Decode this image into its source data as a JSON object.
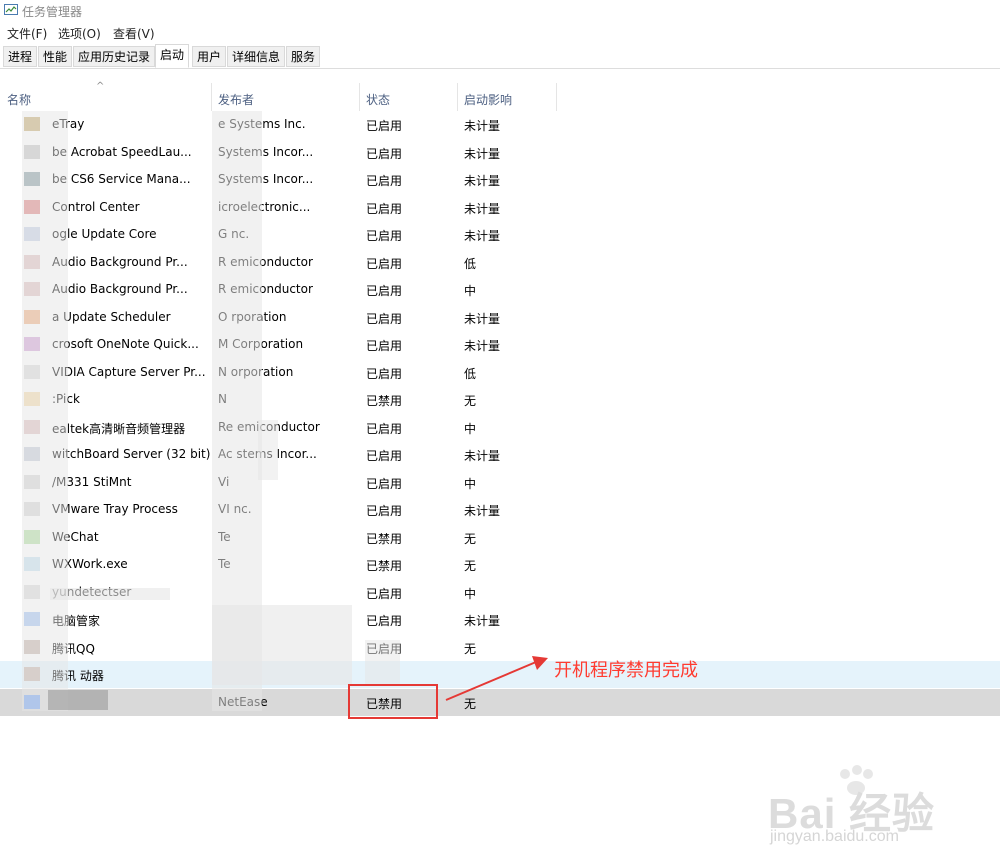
{
  "window": {
    "title": "任务管理器"
  },
  "menu": [
    "文件(F)",
    "选项(O)",
    "查看(V)"
  ],
  "tabs": [
    "进程",
    "性能",
    "应用历史记录",
    "启动",
    "用户",
    "详细信息",
    "服务"
  ],
  "active_tab": "启动",
  "columns": {
    "name": "名称",
    "publisher": "发布者",
    "status": "状态",
    "impact": "启动影响"
  },
  "rows": [
    {
      "name": "eTray",
      "publisher": "e Systems Inc.",
      "status": "已启用",
      "impact": "未计量",
      "icon_color": "#c8b07a"
    },
    {
      "name": "be Acrobat SpeedLau...",
      "publisher": "Systems Incor...",
      "status": "已启用",
      "impact": "未计量",
      "icon_color": "#c9c9c9"
    },
    {
      "name": "be CS6 Service Mana...",
      "publisher": "Systems Incor...",
      "status": "已启用",
      "impact": "未计量",
      "icon_color": "#8fa3a8"
    },
    {
      "name": "Control Center",
      "publisher": "icroelectronic...",
      "status": "已启用",
      "impact": "未计量",
      "icon_color": "#e08a8a"
    },
    {
      "name": "ogle Update Core",
      "publisher": "G      nc.",
      "status": "已启用",
      "impact": "未计量",
      "icon_color": "#c8d3e6"
    },
    {
      "name": "Audio Background Pr...",
      "publisher": "R        emiconductor",
      "status": "已启用",
      "impact": "低",
      "icon_color": "#e0c4c4"
    },
    {
      "name": "Audio Background Pr...",
      "publisher": "R        emiconductor",
      "status": "已启用",
      "impact": "中",
      "icon_color": "#e0c4c4"
    },
    {
      "name": "a Update Scheduler",
      "publisher": "O       rporation",
      "status": "已启用",
      "impact": "未计量",
      "icon_color": "#f0b48a"
    },
    {
      "name": "crosoft OneNote Quick...",
      "publisher": "M         Corporation",
      "status": "已启用",
      "impact": "未计量",
      "icon_color": "#d4a8d9"
    },
    {
      "name": "VIDIA Capture Server Pr...",
      "publisher": "N        orporation",
      "status": "已启用",
      "impact": "低",
      "icon_color": "#dcdcdc"
    },
    {
      "name": ":Pick",
      "publisher": "N",
      "status": "已禁用",
      "impact": "无",
      "icon_color": "#f5ddb0"
    },
    {
      "name": "ealtek高清晰音频管理器",
      "publisher": "Re        emiconductor",
      "status": "已启用",
      "impact": "中",
      "icon_color": "#e0c4c4"
    },
    {
      "name": "witchBoard Server (32 bit)",
      "publisher": "Ac        stems Incor...",
      "status": "已启用",
      "impact": "未计量",
      "icon_color": "#c9cfdb"
    },
    {
      "name": "/M331 StiMnt",
      "publisher": "Vi",
      "status": "已启用",
      "impact": "中",
      "icon_color": "#d8d8d8"
    },
    {
      "name": "VMware Tray Process",
      "publisher": "VI        nc.",
      "status": "已启用",
      "impact": "未计量",
      "icon_color": "#d8d8d8"
    },
    {
      "name": "WeChat",
      "publisher": "Te",
      "status": "已禁用",
      "impact": "无",
      "icon_color": "#b7e0a8"
    },
    {
      "name": "WXWork.exe",
      "publisher": "Te",
      "status": "已禁用",
      "impact": "无",
      "icon_color": "#c9e3f0"
    },
    {
      "name": "yundetectser",
      "publisher": "",
      "status": "已启用",
      "impact": "中",
      "icon_color": "#dcdcdc"
    },
    {
      "name": "电脑管家",
      "publisher": "",
      "status": "已启用",
      "impact": "未计量",
      "icon_color": "#a9c6f2"
    },
    {
      "name": "腾讯QQ",
      "publisher": "",
      "status": "已启用",
      "impact": "无",
      "icon_color": "#c9b9b0"
    },
    {
      "name": "腾讯          动器",
      "publisher": "",
      "status": "",
      "impact": "",
      "icon_color": "#c9b9b0"
    },
    {
      "name": "",
      "publisher": "NetEase",
      "status": "已禁用",
      "impact": "无",
      "icon_color": "#7aa6ee"
    }
  ],
  "annotation": {
    "text": "开机程序禁用完成",
    "color": "#ff3b30"
  },
  "watermark": {
    "brand": "Bai 经验",
    "url": "jingyan.baidu.com"
  }
}
